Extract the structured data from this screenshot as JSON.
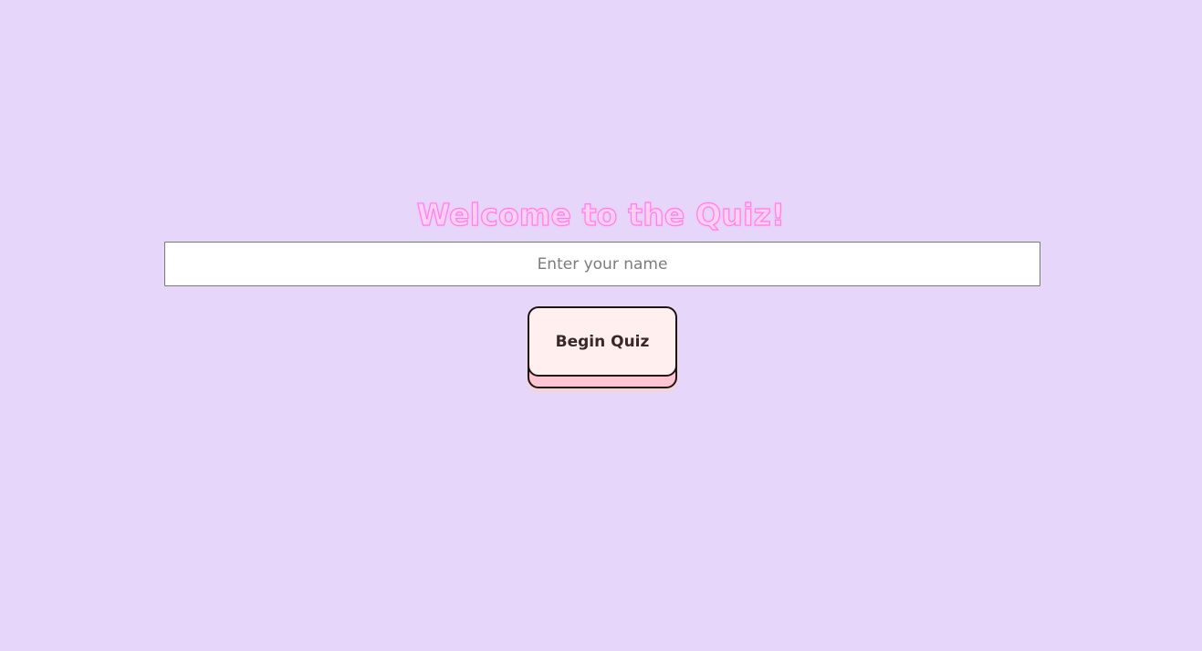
{
  "welcome": {
    "title": "Welcome to the Quiz!"
  },
  "name_input": {
    "value": "",
    "placeholder": "Enter your name"
  },
  "begin_button": {
    "label": "Begin Quiz"
  },
  "colors": {
    "background": "#e6d7fa",
    "title_fill": "#ffd0f4",
    "title_outline": "#ff80e6",
    "button_face": "#fff0ef",
    "button_base": "#ffc5d3",
    "button_border": "#1e1414"
  }
}
